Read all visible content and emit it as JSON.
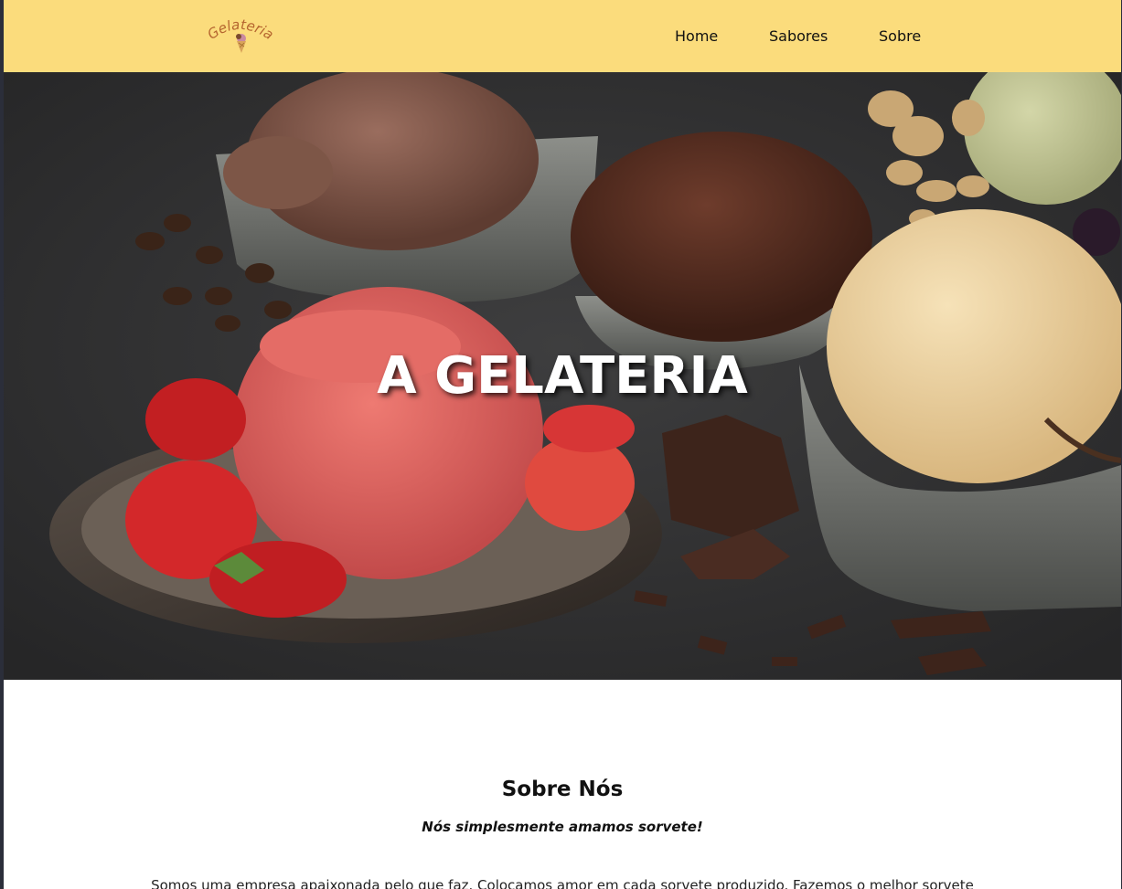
{
  "brand": {
    "logo_text": "Gelateria",
    "logo_icon": "ice-cream-cone-icon"
  },
  "nav": {
    "items": [
      {
        "label": "Home"
      },
      {
        "label": "Sabores"
      },
      {
        "label": "Sobre"
      }
    ]
  },
  "hero": {
    "title": "A GELATERIA",
    "image": "ice-cream-scoops-photo"
  },
  "about": {
    "title": "Sobre Nós",
    "subtitle": "Nós simplesmente amamos sorvete!",
    "text": "Somos uma empresa apaixonada pelo que faz. Colocamos amor em cada sorvete produzido. Fazemos o melhor sorvete"
  },
  "colors": {
    "header_bg": "#fbdc7c",
    "logo": "#b5652f",
    "page_bg": "#ffffff",
    "frame": "#2b2e3a"
  }
}
